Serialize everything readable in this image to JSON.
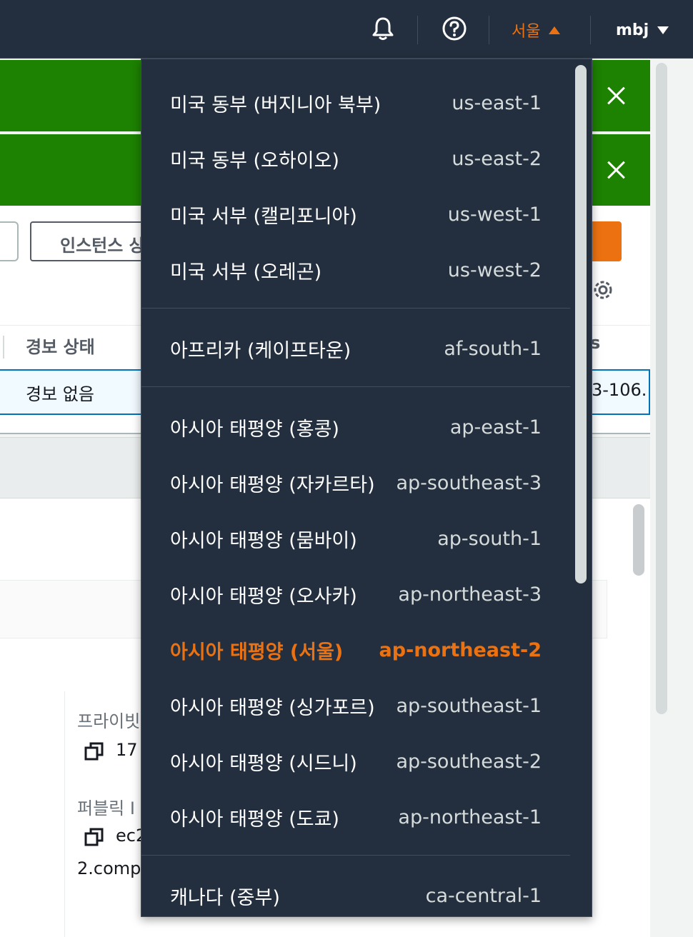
{
  "header": {
    "region_label": "서울",
    "user_label": "mbj",
    "icons": [
      "bell-icon",
      "help-icon"
    ]
  },
  "toolbar": {
    "state_button_label": "인스턴스 상"
  },
  "table": {
    "alarm_header": "경보 상태",
    "alarm_value": "경보 없음",
    "cut_header": "s",
    "cut_value": "3-106."
  },
  "details": {
    "private_label": "프라이빗",
    "private_value": "17",
    "public_label": "퍼블릭 I",
    "public_value_1": "ec2",
    "public_value_2": "2.comp"
  },
  "region_menu": {
    "groups": [
      [
        {
          "name": "미국 동부 (버지니아 북부)",
          "code": "us-east-1"
        },
        {
          "name": "미국 동부 (오하이오)",
          "code": "us-east-2"
        },
        {
          "name": "미국 서부 (캘리포니아)",
          "code": "us-west-1"
        },
        {
          "name": "미국 서부 (오레곤)",
          "code": "us-west-2"
        }
      ],
      [
        {
          "name": "아프리카 (케이프타운)",
          "code": "af-south-1"
        }
      ],
      [
        {
          "name": "아시아 태평양 (홍콩)",
          "code": "ap-east-1"
        },
        {
          "name": "아시아 태평양 (자카르타)",
          "code": "ap-southeast-3"
        },
        {
          "name": "아시아 태평양 (뭄바이)",
          "code": "ap-south-1"
        },
        {
          "name": "아시아 태평양 (오사카)",
          "code": "ap-northeast-3"
        },
        {
          "name": "아시아 태평양 (서울)",
          "code": "ap-northeast-2",
          "selected": true
        },
        {
          "name": "아시아 태평양 (싱가포르)",
          "code": "ap-southeast-1"
        },
        {
          "name": "아시아 태평양 (시드니)",
          "code": "ap-southeast-2"
        },
        {
          "name": "아시아 태평양 (도쿄)",
          "code": "ap-northeast-1"
        }
      ],
      [
        {
          "name": "캐나다 (중부)",
          "code": "ca-central-1"
        }
      ]
    ]
  },
  "colors": {
    "nav_bg": "#232f3e",
    "accent": "#ec7211",
    "success": "#1d8102"
  }
}
